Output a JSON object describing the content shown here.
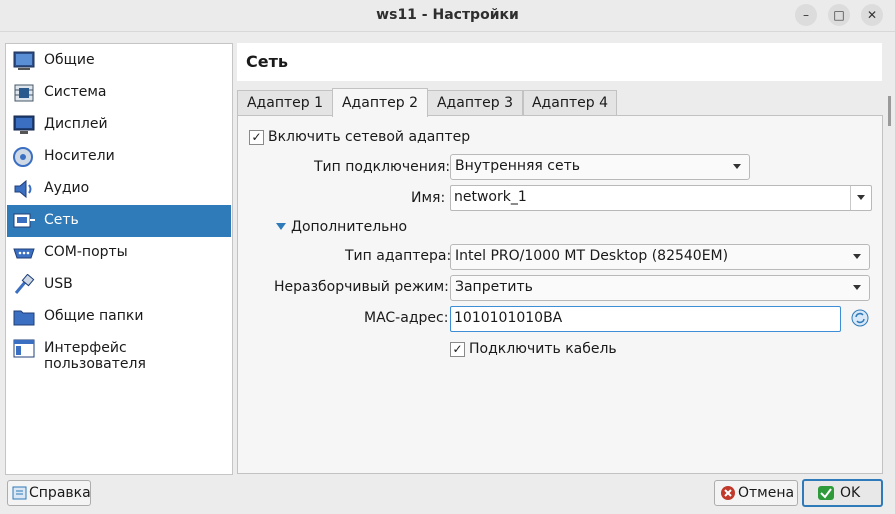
{
  "window": {
    "title": "ws11 - Настройки"
  },
  "sidebar": {
    "items": [
      {
        "label": "Общие",
        "icon": "general-icon"
      },
      {
        "label": "Система",
        "icon": "system-icon"
      },
      {
        "label": "Дисплей",
        "icon": "display-icon"
      },
      {
        "label": "Носители",
        "icon": "storage-icon"
      },
      {
        "label": "Аудио",
        "icon": "audio-icon"
      },
      {
        "label": "Сеть",
        "icon": "network-icon",
        "selected": true
      },
      {
        "label": "COM-порты",
        "icon": "serial-ports-icon"
      },
      {
        "label": "USB",
        "icon": "usb-icon"
      },
      {
        "label": "Общие папки",
        "icon": "shared-folders-icon"
      },
      {
        "label": "Интерфейс пользователя",
        "icon": "user-interface-icon"
      }
    ]
  },
  "page": {
    "title": "Сеть"
  },
  "tabs": [
    "Адаптер 1",
    "Адаптер 2",
    "Адаптер 3",
    "Адаптер 4"
  ],
  "active_tab": "Адаптер 2",
  "adapter": {
    "enable_label": "Включить сетевой адаптер",
    "enable_checked": true,
    "attached_label": "Тип подключения:",
    "attached_value": "Внутренняя сеть",
    "name_label": "Имя:",
    "name_value": "network_1",
    "advanced_label": "Дополнительно",
    "adapter_type_label": "Тип адаптера:",
    "adapter_type_value": "Intel PRO/1000 MT Desktop (82540EM)",
    "promisc_label": "Неразборчивый режим:",
    "promisc_value": "Запретить",
    "mac_label": "MAC-адрес:",
    "mac_value": "1010101010BA",
    "cable_label": "Подключить кабель",
    "cable_checked": true
  },
  "buttons": {
    "help": "Справка",
    "cancel": "Отмена",
    "ok": "OK"
  },
  "colors": {
    "selection": "#2f7ab8",
    "cancel_icon": "#c0392b",
    "ok_icon": "#2e9a3a"
  }
}
